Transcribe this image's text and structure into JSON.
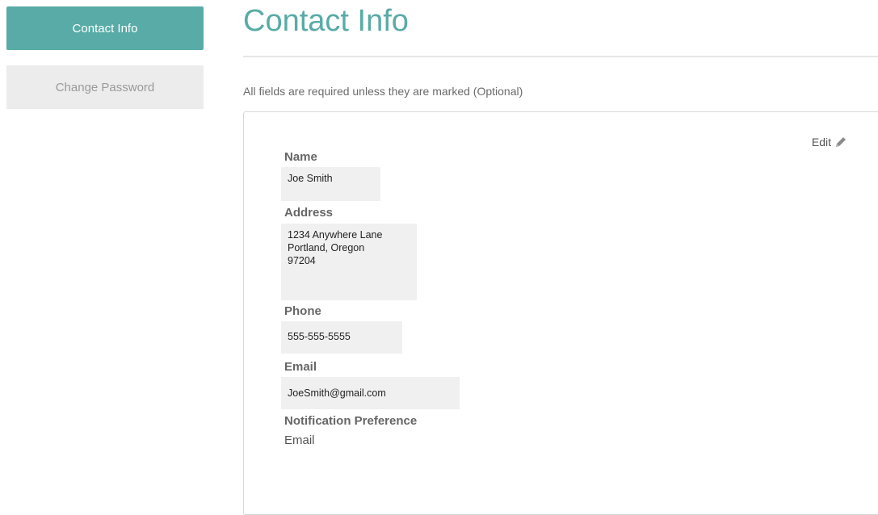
{
  "sidebar": {
    "items": [
      {
        "label": "Contact Info",
        "active": true
      },
      {
        "label": "Change Password",
        "active": false
      }
    ]
  },
  "main": {
    "title": "Contact Info",
    "required_note": "All fields are required unless they are marked (Optional)",
    "edit_label": "Edit",
    "edit_icon": "pencil-icon",
    "fields": {
      "name": {
        "label": "Name",
        "value": "Joe Smith"
      },
      "address": {
        "label": "Address",
        "lines": [
          "1234 Anywhere Lane",
          "Portland, Oregon",
          "97204"
        ]
      },
      "phone": {
        "label": "Phone",
        "value": "555-555-5555"
      },
      "email": {
        "label": "Email",
        "value": "JoeSmith@gmail.com"
      },
      "notification": {
        "label": "Notification Preference",
        "value": "Email"
      }
    }
  },
  "colors": {
    "accent": "#58aba6",
    "inactive_bg": "#ececec",
    "field_bg": "#f0f0f0"
  }
}
